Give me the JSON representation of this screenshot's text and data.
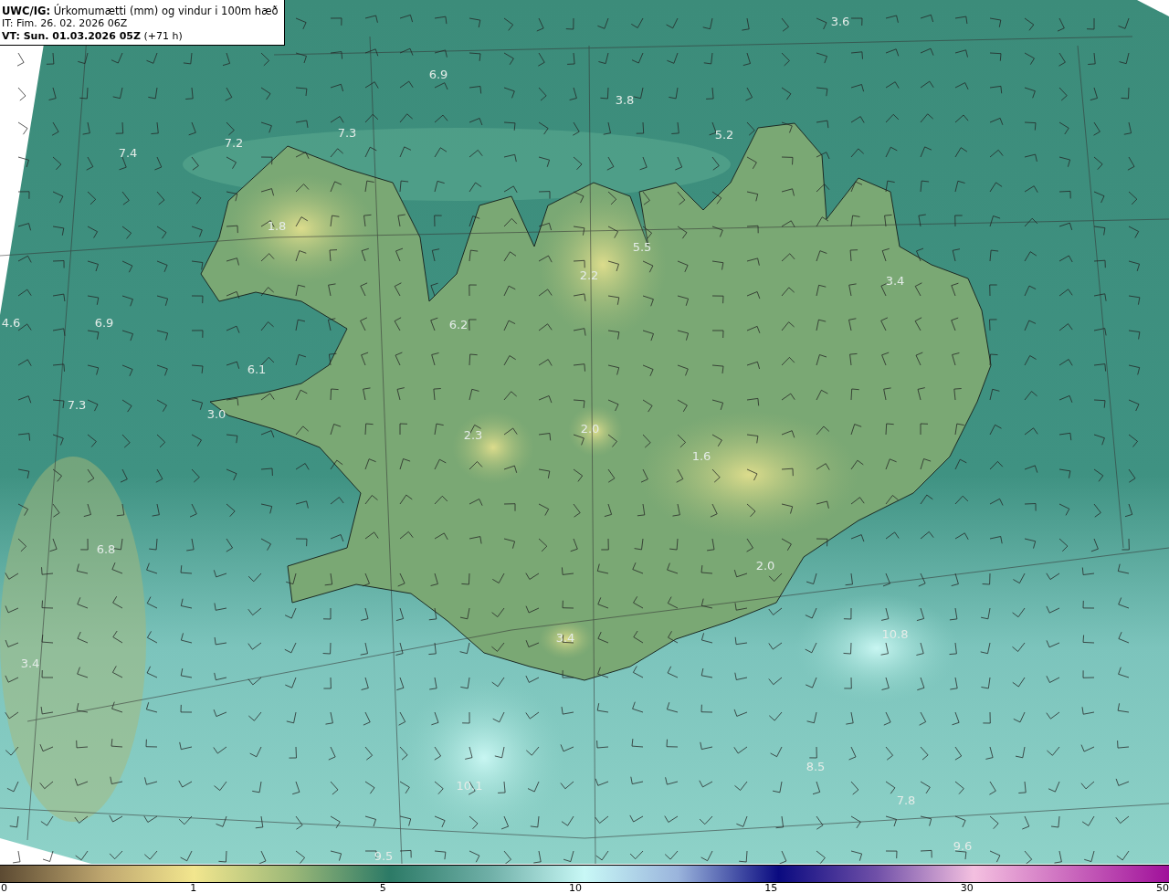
{
  "header": {
    "title": "**UWC/IG:** Úrkomumætti (mm) og vindur i 100m hæð",
    "issue_time": "IT: Fim. 26. 02. 2026 06Z",
    "valid_time": "**VT: Sun. 01.03.2026 05Z** (+71 h)"
  },
  "map": {
    "value_labels": [
      "3.6",
      "6.9",
      "3.8",
      "7.3",
      "5.2",
      "7.4",
      "7.2",
      "1.8",
      "5.5",
      "2.2",
      "3.4",
      "4.6",
      "6.9",
      "6.2",
      "6.1",
      "7.3",
      "3.0",
      "2.3",
      "2.0",
      "1.6",
      "6.8",
      "2.0",
      "3.4",
      "3.4",
      "10.8",
      "10.1",
      "8.5",
      "7.8",
      "9.5",
      "9.6"
    ]
  },
  "colorbar": {
    "ticks": [
      "0",
      "1",
      "5",
      "10",
      "15",
      "30",
      "50"
    ]
  }
}
